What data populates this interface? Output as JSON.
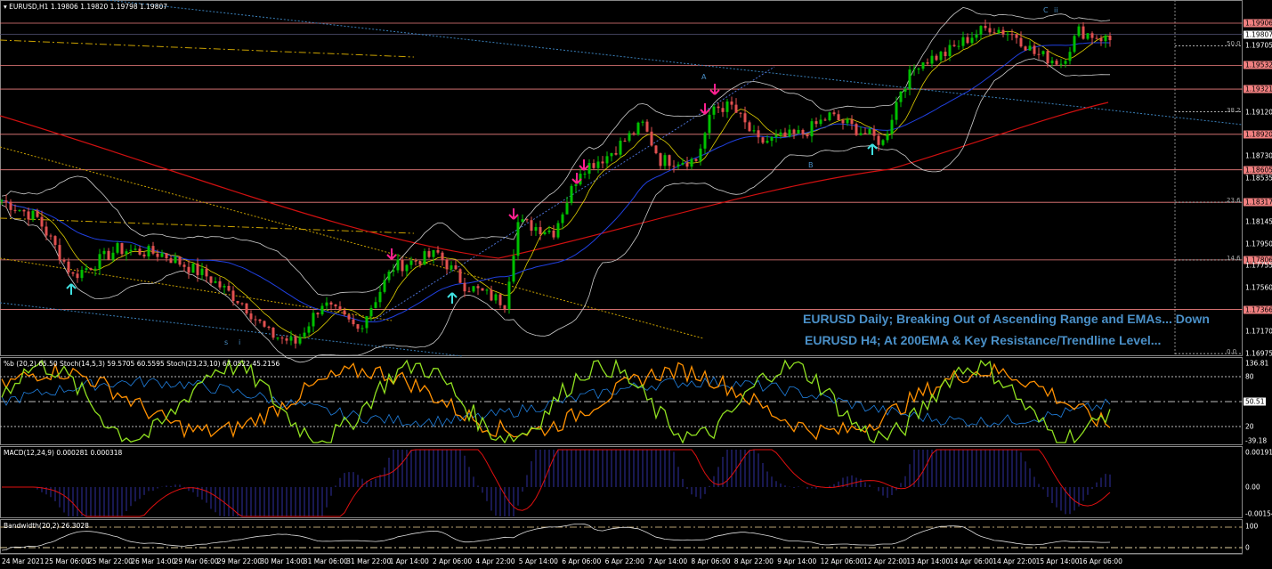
{
  "header": {
    "symbol": "EURUSD,H1",
    "ohlc": "1.19806 1.19820 1.19798 1.19807"
  },
  "price_axis": {
    "current": "1.19807",
    "levels": [
      "1.19906",
      "1.19532",
      "1.19321",
      "1.18920",
      "1.18605",
      "1.18317",
      "1.17806",
      "1.17366"
    ],
    "ticks": [
      "1.19705",
      "1.19120",
      "1.18730",
      "1.18535",
      "1.18145",
      "1.17950",
      "1.17755",
      "1.17560",
      "1.17170",
      "1.16975"
    ],
    "fib": [
      "50.0",
      "38.2",
      "23.6",
      "14.6",
      "0.0"
    ]
  },
  "annotations": {
    "line1": "EURUSD Daily; Breaking Out of Ascending Range and EMAs... Down",
    "line2": "EURUSD H4; At 200EMA & Key Resistance/Trendline Level...",
    "waves": [
      "A",
      "B",
      "C",
      "ii",
      "s",
      "i"
    ]
  },
  "stoch_pane": {
    "title": "%b (20,2) 65.50  Stoch(14,5,3) 59.5705 60.5595  Stoch(23,23,10) 67.0522 45.2156",
    "max": "136.81",
    "l80": "80",
    "current": "50.51",
    "l20": "20",
    "min": "-39.18"
  },
  "macd_pane": {
    "title": "MACD(12,24,9) 0.000281 0.000318",
    "max": "0.001913",
    "zero": "0.00",
    "min": "-0.001543"
  },
  "bw_pane": {
    "title": "Bandwidth(20,2) 26.3028",
    "max": "100",
    "min": "0"
  },
  "time_axis": [
    "24 Mar 2021",
    "25 Mar 06:00",
    "25 Mar 22:00",
    "26 Mar 14:00",
    "29 Mar 06:00",
    "29 Mar 22:00",
    "30 Mar 14:00",
    "31 Mar 06:00",
    "31 Mar 22:00",
    "1 Apr 14:00",
    "2 Apr 06:00",
    "4 Apr 22:00",
    "5 Apr 14:00",
    "6 Apr 06:00",
    "6 Apr 22:00",
    "7 Apr 14:00",
    "8 Apr 06:00",
    "8 Apr 22:00",
    "9 Apr 14:00",
    "12 Apr 06:00",
    "12 Apr 22:00",
    "13 Apr 14:00",
    "14 Apr 06:00",
    "14 Apr 22:00",
    "15 Apr 14:00",
    "16 Apr 06:00"
  ],
  "chart_data": {
    "type": "candlestick",
    "price_range": [
      1.16975,
      1.19906
    ],
    "waypoints": [
      [
        0,
        1.18334
      ],
      [
        8,
        1.18176
      ],
      [
        16,
        1.17663
      ],
      [
        26,
        1.179
      ],
      [
        36,
        1.1786
      ],
      [
        46,
        1.17663
      ],
      [
        54,
        1.17426
      ],
      [
        60,
        1.1715
      ],
      [
        66,
        1.1707
      ],
      [
        72,
        1.17426
      ],
      [
        80,
        1.17189
      ],
      [
        88,
        1.17742
      ],
      [
        98,
        1.1786
      ],
      [
        104,
        1.17584
      ],
      [
        113,
        1.17426
      ],
      [
        116,
        1.18137
      ],
      [
        124,
        1.18058
      ],
      [
        130,
        1.18611
      ],
      [
        136,
        1.18729
      ],
      [
        144,
        1.19006
      ],
      [
        148,
        1.1869
      ],
      [
        156,
        1.1869
      ],
      [
        160,
        1.19163
      ],
      [
        164,
        1.19163
      ],
      [
        170,
        1.18847
      ],
      [
        180,
        1.18927
      ],
      [
        186,
        1.19084
      ],
      [
        194,
        1.18927
      ],
      [
        198,
        1.18847
      ],
      [
        202,
        1.19321
      ],
      [
        206,
        1.19558
      ],
      [
        212,
        1.19637
      ],
      [
        218,
        1.19795
      ],
      [
        222,
        1.19874
      ],
      [
        228,
        1.19795
      ],
      [
        232,
        1.19637
      ],
      [
        238,
        1.19558
      ],
      [
        242,
        1.19835
      ],
      [
        249,
        1.19756
      ]
    ],
    "up_color": "#00c000",
    "down_color": "#e05050"
  }
}
